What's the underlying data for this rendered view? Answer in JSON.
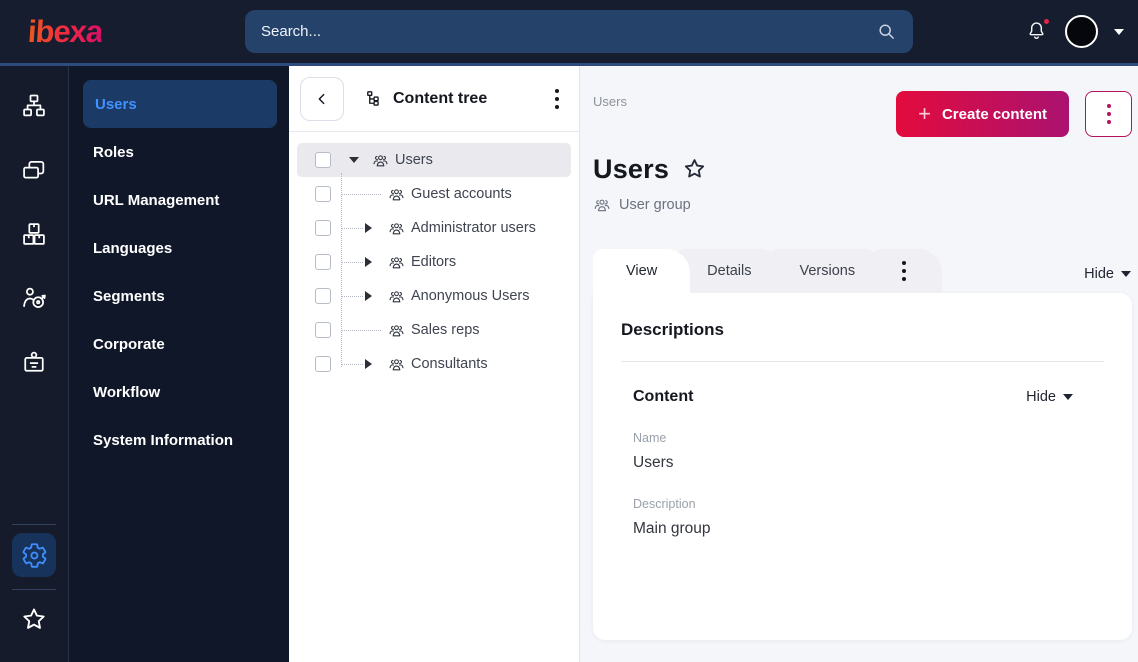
{
  "topbar": {
    "logo_text": "ibexa",
    "search_placeholder": "Search...",
    "has_notification": true
  },
  "icon_rail": {
    "items": [
      "sitemap-icon",
      "pages-icon",
      "product-boxes-icon",
      "audience-target-icon",
      "id-badge-icon"
    ],
    "bottom_items": [
      "gear-icon",
      "star-icon"
    ],
    "active_item": "gear-icon"
  },
  "sidebar": {
    "items": [
      {
        "label": "Users",
        "active": true
      },
      {
        "label": "Roles",
        "active": false
      },
      {
        "label": "URL Management",
        "active": false
      },
      {
        "label": "Languages",
        "active": false
      },
      {
        "label": "Segments",
        "active": false
      },
      {
        "label": "Corporate",
        "active": false
      },
      {
        "label": "Workflow",
        "active": false
      },
      {
        "label": "System Information",
        "active": false
      }
    ]
  },
  "content_tree": {
    "title": "Content tree",
    "items": [
      {
        "label": "Users",
        "level": 0,
        "expanded": true,
        "selected": true,
        "has_children": true
      },
      {
        "label": "Guest accounts",
        "level": 1,
        "has_children": false
      },
      {
        "label": "Administrator users",
        "level": 1,
        "has_children": true
      },
      {
        "label": "Editors",
        "level": 1,
        "has_children": true
      },
      {
        "label": "Anonymous Users",
        "level": 1,
        "has_children": true
      },
      {
        "label": "Sales reps",
        "level": 1,
        "has_children": false
      },
      {
        "label": "Consultants",
        "level": 1,
        "has_children": true
      }
    ]
  },
  "main": {
    "breadcrumb": "Users",
    "create_button_label": "Create content",
    "plus_glyph": "+",
    "page_title": "Users",
    "content_type_label": "User group",
    "tabs": [
      {
        "label": "View",
        "active": true
      },
      {
        "label": "Details",
        "active": false
      },
      {
        "label": "Versions",
        "active": false
      }
    ],
    "hide_toggle_label": "Hide",
    "card": {
      "heading": "Descriptions",
      "section": {
        "title": "Content",
        "hide_toggle_label": "Hide",
        "fields": [
          {
            "label": "Name",
            "value": "Users"
          },
          {
            "label": "Description",
            "value": "Main group"
          }
        ]
      }
    }
  },
  "colors": {
    "topbar_bg": "#161d2f",
    "topbar_underline": "#2d4b7f",
    "search_bg": "#25426b",
    "sidebar_bg": "#101729",
    "active_item_bg": "#1c3a66",
    "accent_blue": "#4191ff",
    "primary_gradient_start": "#e30b3d",
    "primary_gradient_end": "#aa1270",
    "badge_red": "#e0244a",
    "main_bg": "#f4f6fa",
    "selected_row_bg": "#e9e9ee"
  }
}
